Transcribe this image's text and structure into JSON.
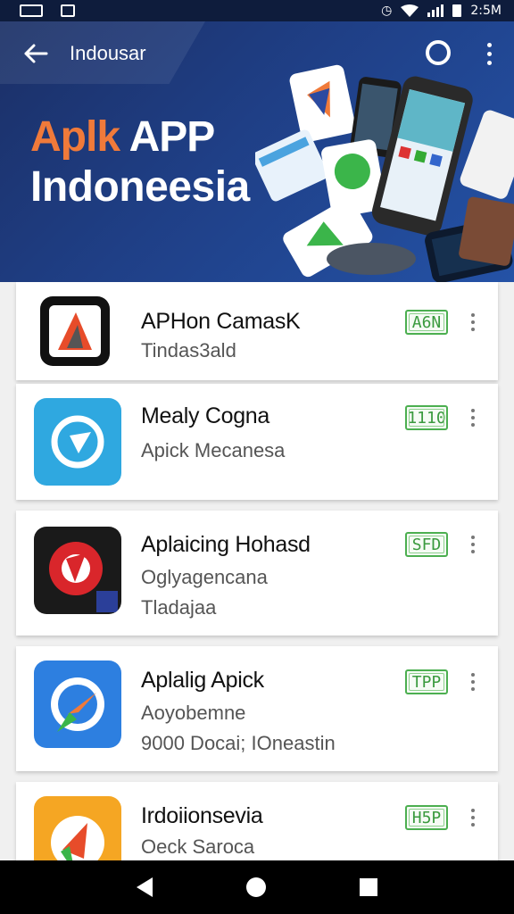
{
  "status_bar": {
    "time": "2:5M"
  },
  "app_bar": {
    "title": "Indousar"
  },
  "banner": {
    "headline_part1": "Aplk",
    "headline_part2": "APP",
    "headline_line2": "Indoneesia"
  },
  "apps": [
    {
      "name": "APHon CamasK",
      "subtitle": "Tindas3ald",
      "subtitle2": "",
      "badge": "A6N"
    },
    {
      "name": "Mealy Cogna",
      "subtitle": "Apick Mecanesa",
      "subtitle2": "",
      "badge": "1110"
    },
    {
      "name": "Aplaicing Hohasd",
      "subtitle": "Oglyagencana",
      "subtitle2": "Tladajaa",
      "badge": "SFD"
    },
    {
      "name": "Aplalig Apick",
      "subtitle": "Aoyobemne",
      "subtitle2": "9000 Docai; IOneastin",
      "badge": "TPP"
    },
    {
      "name": "Irdoiionsevia",
      "subtitle": "Oeck Saroca",
      "subtitle2": "",
      "badge": "H5P"
    }
  ],
  "colors": {
    "banner": "#1f3f86",
    "accent_orange": "#f07a3a",
    "badge_green": "#4caf50"
  }
}
